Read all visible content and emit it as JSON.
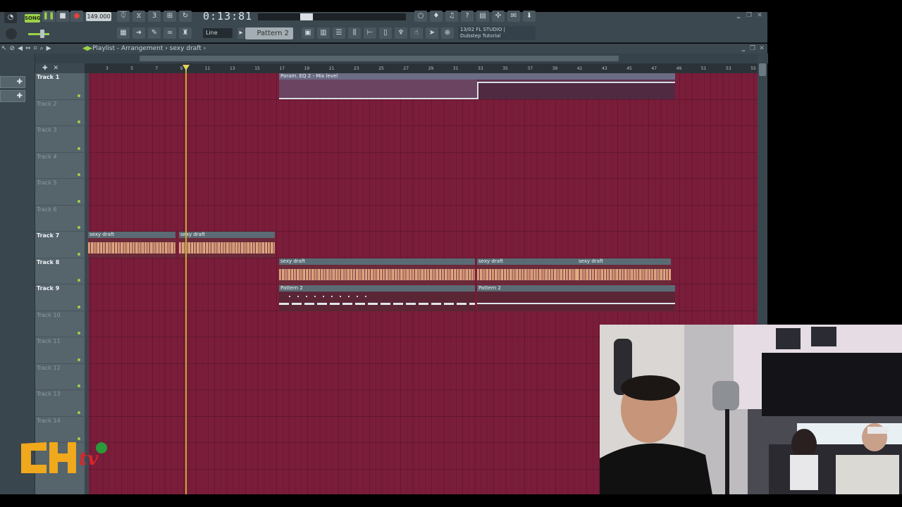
{
  "toolbar": {
    "mode": "SONG",
    "tempo": "149.000",
    "time": "0:13:81",
    "snap": "Line",
    "pattern": "Pattern 2",
    "hint_line1": "13/02 FL STUDIO |",
    "hint_line2": "Dubstep Tutorial"
  },
  "playlist": {
    "title": "Playlist - Arrangement › sexy draft ›"
  },
  "ruler": {
    "bars": [
      "3",
      "5",
      "7",
      "9",
      "11",
      "13",
      "15",
      "17",
      "19",
      "21",
      "23",
      "25",
      "27",
      "29",
      "31",
      "33",
      "35",
      "37",
      "39",
      "41",
      "43",
      "45",
      "47",
      "49",
      "51",
      "53",
      "55"
    ]
  },
  "tracks": [
    {
      "name": "Track 1",
      "active": true
    },
    {
      "name": "Track 2",
      "active": false
    },
    {
      "name": "Track 3",
      "active": false
    },
    {
      "name": "Track 4",
      "active": false
    },
    {
      "name": "Track 5",
      "active": false
    },
    {
      "name": "Track 6",
      "active": false
    },
    {
      "name": "Track 7",
      "active": true
    },
    {
      "name": "Track 8",
      "active": true
    },
    {
      "name": "Track 9",
      "active": true
    },
    {
      "name": "Track 10",
      "active": false
    },
    {
      "name": "Track 11",
      "active": false
    },
    {
      "name": "Track 12",
      "active": false
    },
    {
      "name": "Track 13",
      "active": false
    },
    {
      "name": "Track 14",
      "active": false
    }
  ],
  "clips": {
    "automation_label": "Param. EQ 2 - Mix level",
    "audio_label": "sexy draft",
    "pattern_label": "Pattern 2"
  },
  "logo": {
    "text": "CH tv"
  }
}
